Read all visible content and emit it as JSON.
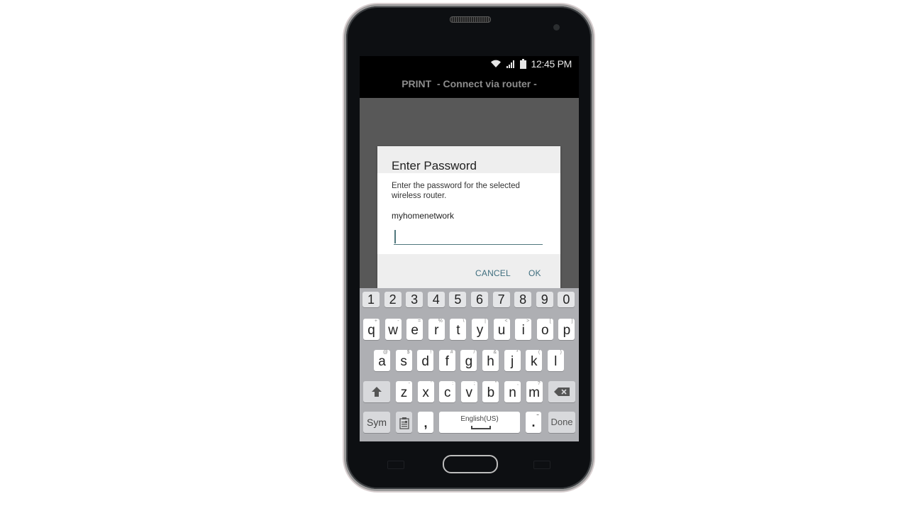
{
  "status_bar": {
    "time": "12:45 PM",
    "icons": [
      "wifi-icon",
      "signal-icon",
      "battery-icon"
    ]
  },
  "app_bar": {
    "title": "PRINT  - Connect via router -"
  },
  "dialog": {
    "title": "Enter Password",
    "message": "Enter the password for the selected wireless router.",
    "network_name": "myhomenetwork",
    "password_value": "",
    "cancel_label": "CANCEL",
    "ok_label": "OK"
  },
  "keyboard": {
    "number_row": [
      "1",
      "2",
      "3",
      "4",
      "5",
      "6",
      "7",
      "8",
      "9",
      "0"
    ],
    "row1": [
      {
        "key": "q",
        "alt": "+"
      },
      {
        "key": "w",
        "alt": "-"
      },
      {
        "key": "e",
        "alt": "="
      },
      {
        "key": "r",
        "alt": "%"
      },
      {
        "key": "t",
        "alt": "\\"
      },
      {
        "key": "y",
        "alt": "|"
      },
      {
        "key": "u",
        "alt": "<"
      },
      {
        "key": "i",
        "alt": ">"
      },
      {
        "key": "o",
        "alt": "["
      },
      {
        "key": "p",
        "alt": "]"
      }
    ],
    "row2": [
      {
        "key": "a",
        "alt": "@"
      },
      {
        "key": "s",
        "alt": "$"
      },
      {
        "key": "d",
        "alt": "!"
      },
      {
        "key": "f",
        "alt": "#"
      },
      {
        "key": "g",
        "alt": "/"
      },
      {
        "key": "h",
        "alt": "&"
      },
      {
        "key": "j",
        "alt": "*"
      },
      {
        "key": "k",
        "alt": "("
      },
      {
        "key": "l",
        "alt": ")"
      }
    ],
    "row3": [
      {
        "key": "z",
        "alt": "-"
      },
      {
        "key": "x",
        "alt": "'"
      },
      {
        "key": "c",
        "alt": ":"
      },
      {
        "key": "v",
        "alt": ";"
      },
      {
        "key": "b",
        "alt": "\""
      },
      {
        "key": "n",
        "alt": ","
      },
      {
        "key": "m",
        "alt": "?"
      }
    ],
    "sym_label": "Sym",
    "comma_label": ",",
    "space_label": "English(US)",
    "period_label": ".",
    "period_alt": "...",
    "done_label": "Done",
    "colors": {
      "background": "#aeafb3",
      "key": "#ffffff",
      "function_key": "#d8d9dc"
    }
  },
  "colors": {
    "accent": "#3e6e7e",
    "overlay": "#585858"
  }
}
